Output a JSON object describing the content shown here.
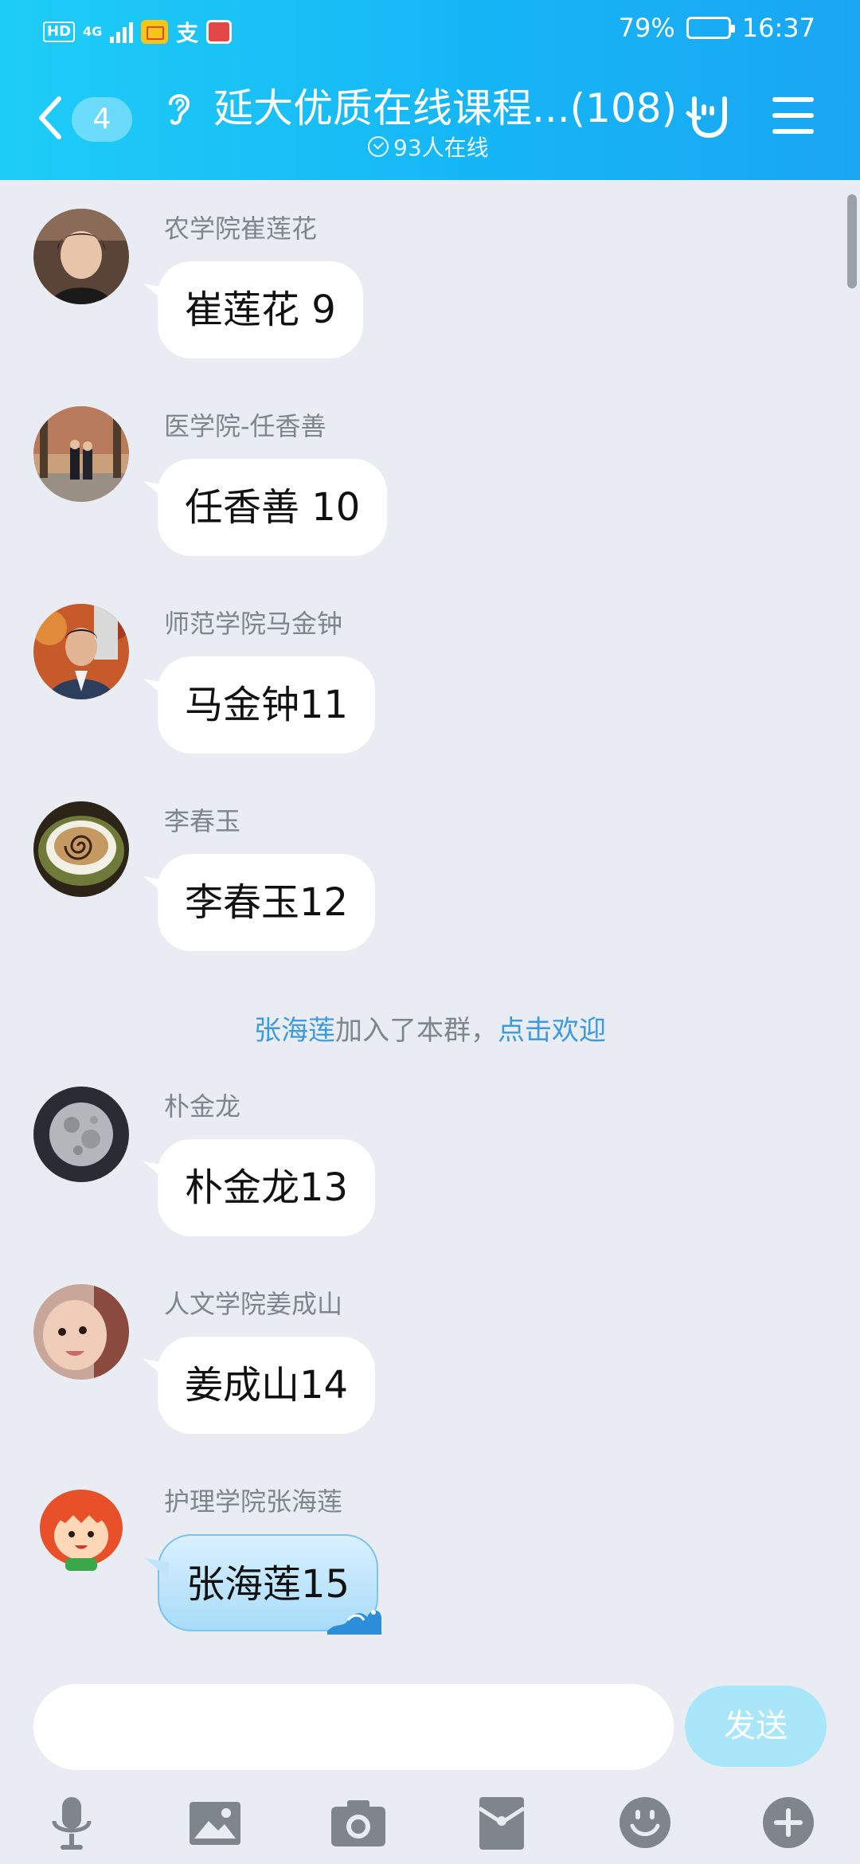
{
  "status_bar": {
    "left_hd": "HD",
    "left_net": "4G",
    "battery_percent_text": "79%",
    "battery_level": 0.79,
    "time": "16:37"
  },
  "header": {
    "unread_count": "4",
    "title": "延大优质在线课程...(108)",
    "online_text": "93人在线"
  },
  "messages": [
    {
      "sender": "农学院崔莲花",
      "text": "崔莲花 9",
      "avatar": "avatar-woman"
    },
    {
      "sender": "医学院-任香善",
      "text": "任香善 10",
      "avatar": "avatar-couple-outdoor"
    },
    {
      "sender": "师范学院马金钟",
      "text": "马金钟11",
      "avatar": "avatar-man-autumn"
    },
    {
      "sender": "李春玉",
      "text": "李春玉12",
      "avatar": "avatar-coffee-cup"
    },
    {
      "sender": "朴金龙",
      "text": "朴金龙13",
      "avatar": "avatar-moon"
    },
    {
      "sender": "人文学院姜成山",
      "text": "姜成山14",
      "avatar": "avatar-baby"
    },
    {
      "sender": "护理学院张海莲",
      "text": "张海莲15",
      "avatar": "avatar-cartoon-girl"
    }
  ],
  "system_message": {
    "name": "张海莲",
    "middle": "加入了本群，",
    "action": "点击欢迎"
  },
  "input": {
    "value": "",
    "send_label": "发送"
  },
  "toolbar": [
    "microphone-icon",
    "image-icon",
    "camera-icon",
    "red-envelope-icon",
    "emoji-icon",
    "plus-icon"
  ],
  "colors": {
    "header_start": "#1ecdf7",
    "header_end": "#1aa6f3",
    "background": "#e9ecf3",
    "link": "#3b9ae0",
    "send_button": "#a9e6f9"
  }
}
